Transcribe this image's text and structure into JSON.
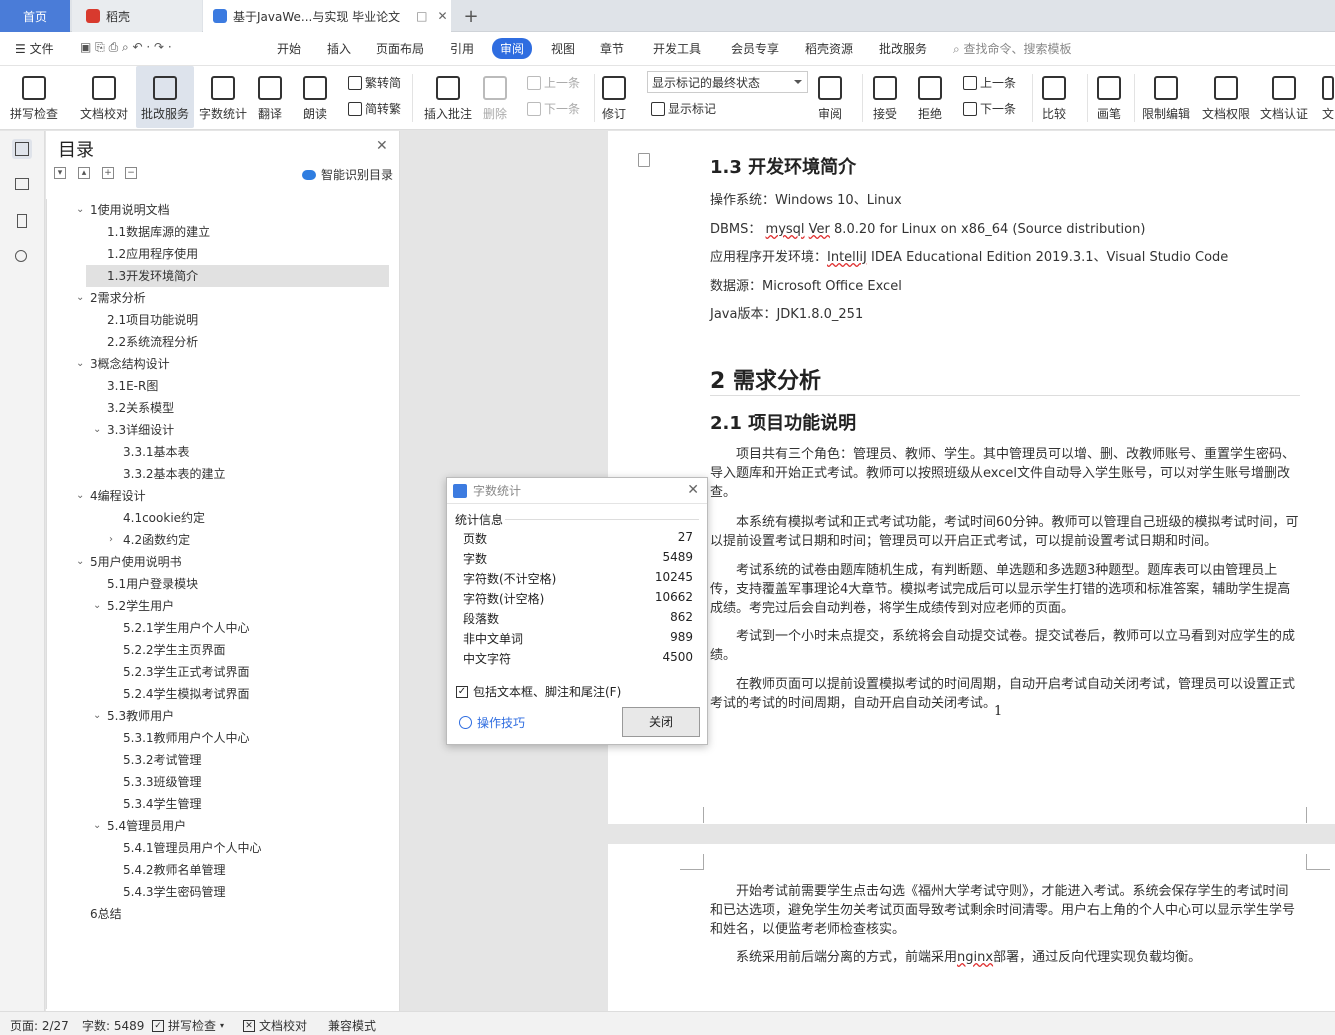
{
  "tabs": {
    "home": "首页",
    "daoke": "稻壳",
    "doc": "基于JavaWe...与实现 毕业论文"
  },
  "menu": {
    "file": "文件",
    "items": [
      "开始",
      "插入",
      "页面布局",
      "引用",
      "审阅",
      "视图",
      "章节",
      "开发工具",
      "会员专享",
      "稻壳资源",
      "批改服务"
    ],
    "search_placeholder": "查找命令、搜索模板"
  },
  "ribbon": {
    "spellcheck": "拼写检查",
    "doccheck": "文档校对",
    "grading": "批改服务",
    "wordcount": "字数统计",
    "translate": "翻译",
    "read_aloud": "朗读",
    "to_traditional": "繁转简",
    "to_simplified": "简转繁",
    "insert_comment": "插入批注",
    "delete": "删除",
    "prev": "上一条",
    "next": "下一条",
    "revise": "修订",
    "mark_state": "显示标记的最终状态",
    "show_marks": "显示标记",
    "review": "审阅",
    "accept": "接受",
    "reject": "拒绝",
    "prev2": "上一条",
    "next2": "下一条",
    "compare": "比较",
    "pen": "画笔",
    "restrict": "限制编辑",
    "permission": "文档权限",
    "certify": "文档认证",
    "cut": "文"
  },
  "toc": {
    "title": "目录",
    "smart": "智能识别目录",
    "items": [
      {
        "label": "1使用说明文档",
        "level": 0,
        "arrow": "open"
      },
      {
        "label": "1.1数据库源的建立",
        "level": 1
      },
      {
        "label": "1.2应用程序使用",
        "level": 1
      },
      {
        "label": "1.3开发环境简介",
        "level": 1,
        "selected": true
      },
      {
        "label": "2需求分析",
        "level": 0,
        "arrow": "open"
      },
      {
        "label": "2.1项目功能说明",
        "level": 1
      },
      {
        "label": "2.2系统流程分析",
        "level": 1
      },
      {
        "label": "3概念结构设计",
        "level": 0,
        "arrow": "open"
      },
      {
        "label": "3.1E-R图",
        "level": 1
      },
      {
        "label": "3.2关系模型",
        "level": 1
      },
      {
        "label": "3.3详细设计",
        "level": 1,
        "arrow": "open"
      },
      {
        "label": "3.3.1基本表",
        "level": 2
      },
      {
        "label": "3.3.2基本表的建立",
        "level": 2
      },
      {
        "label": "4编程设计",
        "level": 0,
        "arrow": "open"
      },
      {
        "label": "4.1cookie约定",
        "level": 2
      },
      {
        "label": "4.2函数约定",
        "level": 2,
        "arrow": "closed"
      },
      {
        "label": "5用户使用说明书",
        "level": 0,
        "arrow": "open"
      },
      {
        "label": "5.1用户登录模块",
        "level": 1
      },
      {
        "label": "5.2学生用户",
        "level": 1,
        "arrow": "open"
      },
      {
        "label": "5.2.1学生用户个人中心",
        "level": 2
      },
      {
        "label": "5.2.2学生主页界面",
        "level": 2
      },
      {
        "label": "5.2.3学生正式考试界面",
        "level": 2
      },
      {
        "label": "5.2.4学生模拟考试界面",
        "level": 2
      },
      {
        "label": "5.3教师用户",
        "level": 1,
        "arrow": "open"
      },
      {
        "label": "5.3.1教师用户个人中心",
        "level": 2
      },
      {
        "label": "5.3.2考试管理",
        "level": 2
      },
      {
        "label": "5.3.3班级管理",
        "level": 2
      },
      {
        "label": "5.3.4学生管理",
        "level": 2
      },
      {
        "label": "5.4管理员用户",
        "level": 1,
        "arrow": "open"
      },
      {
        "label": "5.4.1管理员用户个人中心",
        "level": 2
      },
      {
        "label": "5.4.2教师名单管理",
        "level": 2
      },
      {
        "label": "5.4.3学生密码管理",
        "level": 2
      },
      {
        "label": "6总结",
        "level": 0
      }
    ]
  },
  "doc": {
    "h13": "1.3 开发环境简介",
    "os": "操作系统：Windows 10、Linux",
    "dbms_a": "DBMS： ",
    "dbms_b": "mysql",
    "dbms_c": " ",
    "dbms_d": "Ver",
    "dbms_e": " 8.0.20  for Linux on x86_64 (Source distribution)",
    "env_a": "应用程序开发环境：",
    "env_b": "IntelliJ",
    "env_c": " IDEA Educational Edition 2019.3.1、Visual Studio Code",
    "datasrc": "数据源：Microsoft Office Excel",
    "java": "Java版本：JDK1.8.0_251",
    "h2": "2 需求分析",
    "h21": "2.1 项目功能说明",
    "p1": "项目共有三个角色：管理员、教师、学生。其中管理员可以增、删、改教师账号、重置学生密码、导入题库和开始正式考试。教师可以按照班级从excel文件自动导入学生账号，可以对学生账号增删改查。",
    "p2": "本系统有模拟考试和正式考试功能，考试时间60分钟。教师可以管理自己班级的模拟考试时间，可以提前设置考试日期和时间；管理员可以开启正式考试，可以提前设置考试日期和时间。",
    "p3": "考试系统的试卷由题库随机生成，有判断题、单选题和多选题3种题型。题库表可以由管理员上传，支持覆盖军事理论4大章节。模拟考试完成后可以显示学生打错的选项和标准答案，辅助学生提高成绩。考完过后会自动判卷，将学生成绩传到对应老师的页面。",
    "p4": "考试到一个小时未点提交，系统将会自动提交试卷。提交试卷后，教师可以立马看到对应学生的成绩。",
    "p5": "在教师页面可以提前设置模拟考试的时间周期，自动开启考试自动关闭考试，管理员可以设置正式考试的考试的时间周期，自动开启自动关闭考试。",
    "p6": "开始考试前需要学生点击勾选《福州大学考试守则》，才能进入考试。系统会保存学生的考试时间和已达选项，避免学生勿关考试页面导致考试剩余时间清零。用户右上角的个人中心可以显示学生学号和姓名，以便监考老师检查核实。",
    "p7_a": "系统采用前后端分离的方式，前端采用",
    "p7_b": "nginx",
    "p7_c": "部署，通过反向代理实现负载均衡。",
    "cursor": "1"
  },
  "dialog": {
    "title": "字数统计",
    "section": "统计信息",
    "rows": [
      {
        "label": "页数",
        "value": "27"
      },
      {
        "label": "字数",
        "value": "5489"
      },
      {
        "label": "字符数(不计空格)",
        "value": "10245"
      },
      {
        "label": "字符数(计空格)",
        "value": "10662"
      },
      {
        "label": "段落数",
        "value": "862"
      },
      {
        "label": "非中文单词",
        "value": "989"
      },
      {
        "label": "中文字符",
        "value": "4500"
      }
    ],
    "checkbox": "包括文本框、脚注和尾注(F)",
    "tips": "操作技巧",
    "close": "关闭"
  },
  "status": {
    "page": "页面: 2/27",
    "words": "字数: 5489",
    "spell": "拼写检查",
    "doccheck": "文档校对",
    "compat": "兼容模式"
  },
  "colors": {
    "accent": "#2f6de0",
    "home_tab": "#4a7cd8",
    "daoke": "#d83a2e"
  }
}
